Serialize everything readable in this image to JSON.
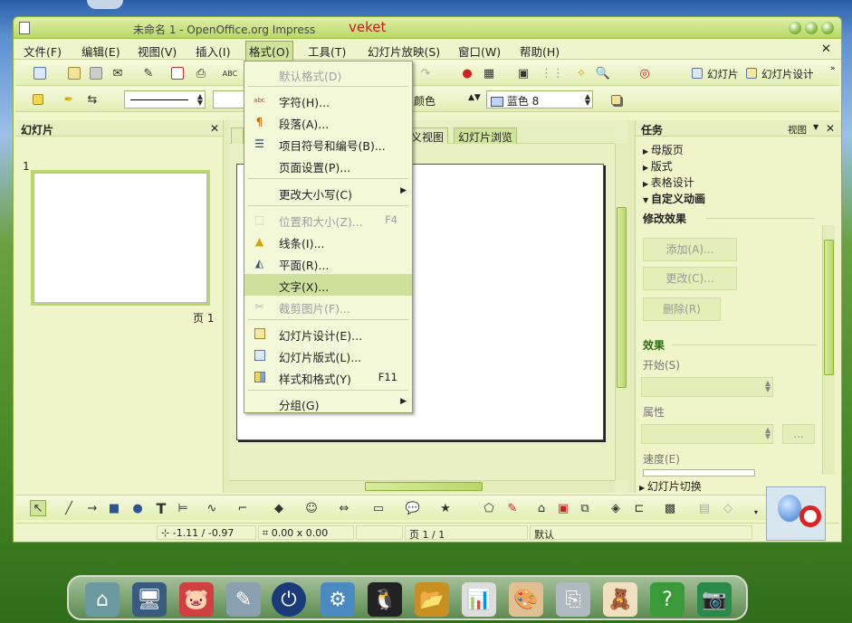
{
  "window": {
    "title": "未命名 1 - OpenOffice.org Impress",
    "brand": "veket"
  },
  "menubar": [
    "文件(F)",
    "编辑(E)",
    "视图(V)",
    "插入(I)",
    "格式(O)",
    "工具(T)",
    "幻灯片放映(S)",
    "窗口(W)",
    "帮助(H)"
  ],
  "toolbar1": {
    "slide_btn": "幻灯片",
    "design_btn": "幻灯片设计"
  },
  "toolbar2": {
    "color_label": "颜色",
    "color_value": "蓝色 8"
  },
  "slides_panel": {
    "title": "幻灯片",
    "slide_number": "1",
    "page_label": "页 1"
  },
  "view_tabs": [
    "义视图",
    "幻灯片浏览"
  ],
  "format_menu": [
    {
      "label": "默认格式(D)",
      "disabled": true
    },
    {
      "label": "字符(H)...",
      "icon": "abc-char-icon"
    },
    {
      "label": "段落(A)...",
      "icon": "paragraph-icon"
    },
    {
      "label": "项目符号和编号(B)...",
      "icon": "bullets-icon"
    },
    {
      "label": "页面设置(P)..."
    },
    {
      "label": "更改大小写(C)",
      "submenu": true
    },
    {
      "label": "位置和大小(Z)...",
      "accel": "F4",
      "disabled": true
    },
    {
      "label": "线条(I)...",
      "icon": "line-icon"
    },
    {
      "label": "平面(R)...",
      "icon": "area-icon"
    },
    {
      "label": "文字(X)...",
      "highlighted": true
    },
    {
      "label": "裁剪图片(F)...",
      "disabled": true
    },
    {
      "label": "幻灯片设计(E)...",
      "icon": "slide-design-icon"
    },
    {
      "label": "幻灯片版式(L)...",
      "icon": "slide-layout-icon"
    },
    {
      "label": "样式和格式(Y)",
      "accel": "F11",
      "icon": "styles-icon"
    },
    {
      "label": "分组(G)",
      "submenu": true
    }
  ],
  "task_panel": {
    "title": "任务",
    "view_btn": "视图",
    "sections": [
      "母版页",
      "版式",
      "表格设计",
      "自定义动画"
    ],
    "modify_effect": "修改效果",
    "add_btn": "添加(A)...",
    "change_btn": "更改(C)...",
    "delete_btn": "删除(R)",
    "effect_label": "效果",
    "start_label": "开始(S)",
    "property_label": "属性",
    "speed_label": "速度(E)",
    "ellipsis": "...",
    "transition": "幻灯片切换"
  },
  "statusbar": {
    "position": "-1.11 / -0.97",
    "size": "0.00 x 0.00",
    "page": "页 1 / 1",
    "layout": "默认"
  },
  "colors": {
    "accent": "#cfe39b",
    "frame": "#8fae3a",
    "brand": "#cc1a1a"
  }
}
